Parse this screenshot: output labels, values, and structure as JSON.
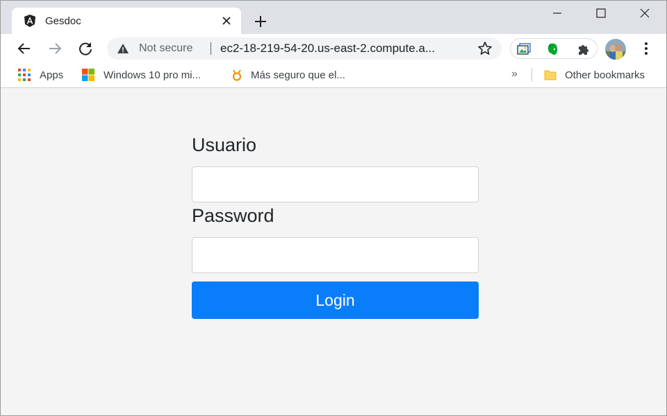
{
  "browser": {
    "tab": {
      "title": "Gesdoc",
      "favicon": "angular-icon"
    },
    "omnibox": {
      "security_label": "Not secure",
      "url": "ec2-18-219-54-20.us-east-2.compute.a..."
    },
    "bookmarks": [
      {
        "label": "Apps",
        "icon": "apps-grid-icon"
      },
      {
        "label": "Windows 10 pro mi...",
        "icon": "windows-logo-icon"
      },
      {
        "label": "Más seguro que el...",
        "icon": "bookmark-favicon-icon"
      }
    ],
    "overflow_label": "»",
    "other_bookmarks_label": "Other bookmarks"
  },
  "login": {
    "user_label": "Usuario",
    "user_value": "",
    "password_label": "Password",
    "password_value": "",
    "submit_label": "Login"
  },
  "colors": {
    "primary_button": "#0a7dfb",
    "page_background": "#f4f4f4",
    "tabstrip": "#dee1e6"
  }
}
